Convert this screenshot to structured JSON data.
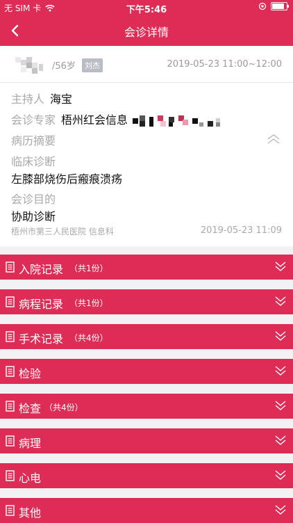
{
  "status": {
    "carrier": "无 SIM 卡",
    "time": "下午5:46"
  },
  "nav": {
    "title": "会诊详情"
  },
  "patient": {
    "age": "/56岁",
    "doctor_tag": "刘杰",
    "time_range": "2019-05-23 11:00~12:00"
  },
  "details": {
    "host_label": "主持人",
    "host_value": "海宝",
    "expert_label": "会诊专家",
    "expert_value": "梧州红会信息",
    "history_label": "病历摘要",
    "diagnosis_label": "临床诊断",
    "diagnosis_value": "左膝部烧伤后瘢痕溃疡",
    "purpose_label": "会诊目的",
    "purpose_value": "协助诊断"
  },
  "footer": {
    "org": "梧州市第三人民医院 信息科",
    "time": "2019-05-23 11:09"
  },
  "sections": [
    {
      "name": "入院记录",
      "count": "（共1份）"
    },
    {
      "name": "病程记录",
      "count": "（共1份）"
    },
    {
      "name": "手术记录",
      "count": "（共4份）"
    },
    {
      "name": "检验",
      "count": ""
    },
    {
      "name": "检查",
      "count": "（共4份）"
    },
    {
      "name": "病理",
      "count": ""
    },
    {
      "name": "心电",
      "count": ""
    },
    {
      "name": "其他",
      "count": ""
    }
  ],
  "icons": {
    "back": "back-arrow-icon",
    "section": "document-icon",
    "expand": "double-chevron-down-icon",
    "collapse": "double-chevron-up-icon"
  },
  "colors": {
    "accent": "#dd2c55"
  }
}
